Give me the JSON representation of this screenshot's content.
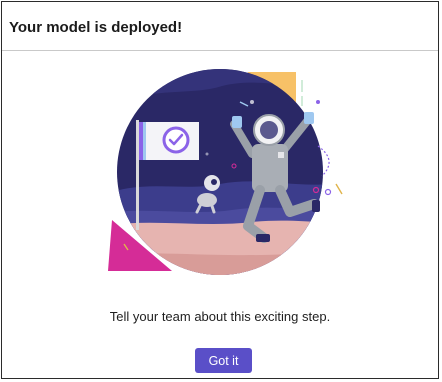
{
  "dialog": {
    "title": "Your model is deployed!",
    "message": "Tell your team about this exciting step.",
    "confirm_label": "Got it"
  },
  "illustration": {
    "icons": [
      "astronaut-icon",
      "flag-icon",
      "checkmark-icon",
      "space-dog-icon",
      "planet-icon"
    ],
    "colors": {
      "sky": "#2a2866",
      "sky_wave": "#3c3d8c",
      "ground": "#e6b4b0",
      "magenta_shape": "#d52c97",
      "yellow_shape": "#f7c167",
      "accent_purple": "#8b63e8",
      "button": "#5a4fc8"
    }
  }
}
